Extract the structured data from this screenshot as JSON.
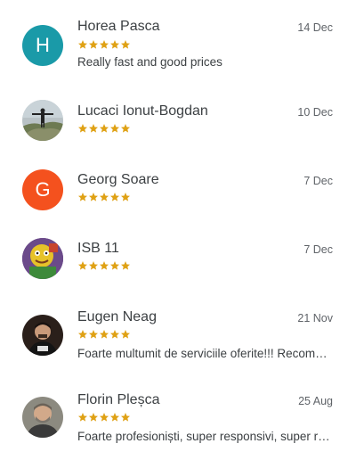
{
  "colors": {
    "star": "#dfa114",
    "avatar_h": "#1a9aa8",
    "avatar_g": "#f4511e"
  },
  "reviews": [
    {
      "initial": "H",
      "name": "Horea Pasca",
      "date": "14 Dec",
      "rating": 5,
      "text": "Really fast and good prices",
      "avatar_icon": "letter-avatar"
    },
    {
      "name": "Lucaci Ionut-Bogdan",
      "date": "10 Dec",
      "rating": 5,
      "text": "",
      "avatar_icon": "person-on-rock-photo"
    },
    {
      "initial": "G",
      "name": "Georg Soare",
      "date": "7 Dec",
      "rating": 5,
      "text": "",
      "avatar_icon": "letter-avatar"
    },
    {
      "name": "ISB 11",
      "date": "7 Dec",
      "rating": 5,
      "text": "",
      "avatar_icon": "cartoon-photo"
    },
    {
      "name": "Eugen Neag",
      "date": "21 Nov",
      "rating": 5,
      "text": "Foarte multumit de serviciile oferite!!! Recomand!",
      "avatar_icon": "man-portrait-photo"
    },
    {
      "name": "Florin Pleșca",
      "date": "25 Aug",
      "rating": 5,
      "text": "Foarte profesioniști, super responsivi, super recomand!",
      "avatar_icon": "man-portrait-photo"
    }
  ]
}
